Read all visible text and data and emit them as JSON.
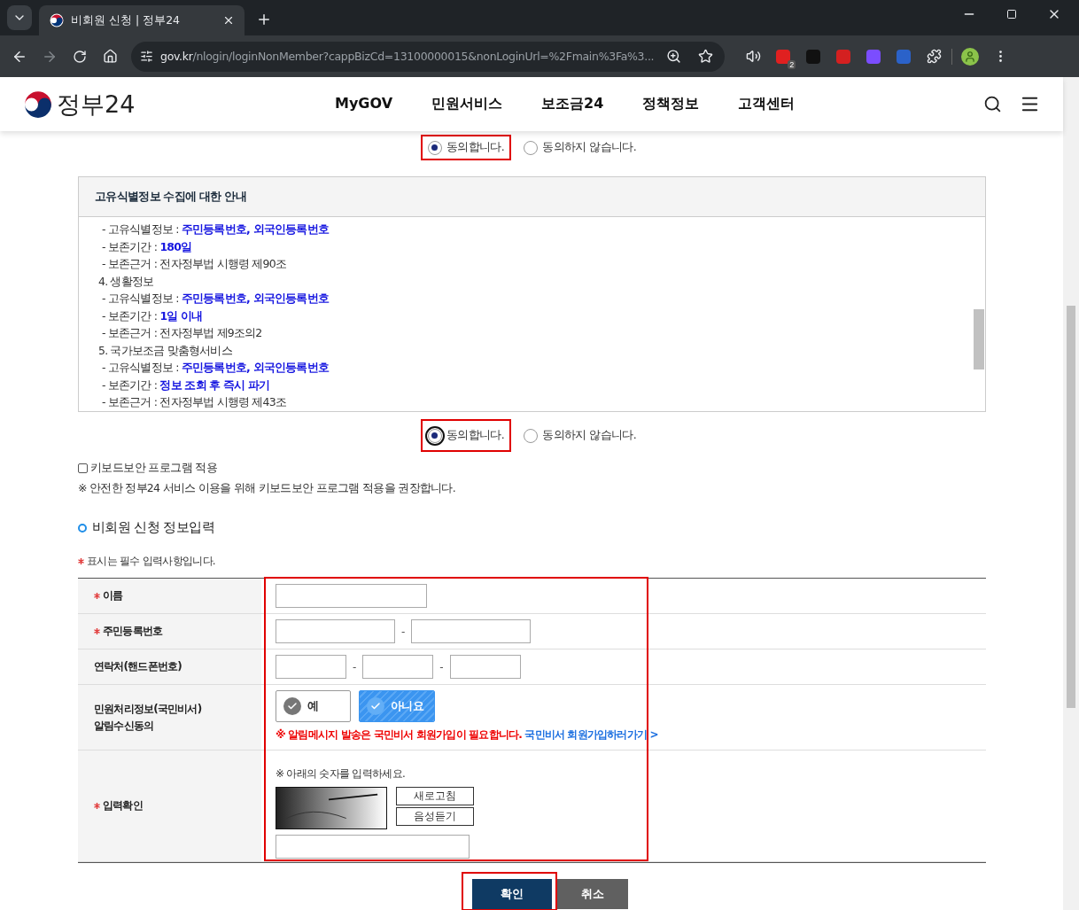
{
  "browser": {
    "tab_title": "비회원 신청 | 정부24",
    "url_host": "gov.kr",
    "url_path": "/nlogin/loginNonMember?cappBizCd=13100000015&nonLoginUrl=%2Fmain%3Fa%3...",
    "extensions": [
      {
        "color": "#e02020",
        "badge": "2"
      },
      {
        "color": "#111111"
      },
      {
        "color": "#d42020"
      },
      {
        "color": "#7b4dff"
      },
      {
        "color": "#2b62c9"
      }
    ]
  },
  "site": {
    "logo": "정부24",
    "nav": [
      "MyGOV",
      "민원서비스",
      "보조금24",
      "정책정보",
      "고객센터"
    ]
  },
  "consent_top": {
    "highlighted": true,
    "options": [
      {
        "label": "동의합니다.",
        "selected": true
      },
      {
        "label": "동의하지 않습니다.",
        "selected": false
      }
    ]
  },
  "notice": {
    "title": "고유식별정보 수집에 대한 안내",
    "lines": [
      {
        "kind": "item",
        "text": "- 고유식별정보 : **주민등록번호, 외국인등록번호**"
      },
      {
        "kind": "item",
        "text": "- 보존기간 : **180일**"
      },
      {
        "kind": "item",
        "text": "- 보존근거 : 전자정부법 시행령 제90조"
      },
      {
        "kind": "heading",
        "text": "4. 생활정보"
      },
      {
        "kind": "item",
        "text": "- 고유식별정보 : **주민등록번호, 외국인등록번호**"
      },
      {
        "kind": "item",
        "text": "- 보존기간 : **1일 이내**"
      },
      {
        "kind": "item",
        "text": "- 보존근거 : 전자정부법 제9조의2"
      },
      {
        "kind": "heading",
        "text": "5. 국가보조금 맞춤형서비스"
      },
      {
        "kind": "item",
        "text": "- 고유식별정보 : **주민등록번호, 외국인등록번호**"
      },
      {
        "kind": "item",
        "text": "- 보존기간 : **정보 조회 후 즉시 파기**"
      },
      {
        "kind": "item",
        "text": "- 보존근거 : 전자정부법 시행령 제43조"
      }
    ]
  },
  "consent_bottom": {
    "highlighted": true,
    "options": [
      {
        "label": "동의합니다.",
        "selected": true
      },
      {
        "label": "동의하지 않습니다.",
        "selected": false
      }
    ]
  },
  "keyboard_security": {
    "label": "키보드보안 프로그램 적용",
    "checked": false,
    "note": "※ 안전한 정부24 서비스 이용을 위해 키보드보안 프로그램 적용을 권장합니다."
  },
  "section_title": "비회원 신청 정보입력",
  "required_note": "표시는 필수 입력사항입니다.",
  "form": {
    "highlighted": true,
    "rows": [
      {
        "kind": "inputs",
        "label": "이름",
        "required": true
      },
      {
        "kind": "inputs",
        "label": "주민등록번호",
        "required": true,
        "separators": [
          "-"
        ]
      },
      {
        "kind": "inputs",
        "label": "연락처(핸드폰번호)",
        "required": false,
        "separators": [
          "-",
          "-"
        ]
      },
      {
        "kind": "choice",
        "label": "민원처리정보(국민비서)\n알림수신동의",
        "required": false,
        "options": [
          {
            "label": "예",
            "selected": false
          },
          {
            "label": "아니요",
            "selected": true
          }
        ],
        "warning": "※ 알림메시지 발송은 국민비서 회원가입이 필요합니다.",
        "link": "국민비서 회원가입하러가기 >"
      },
      {
        "kind": "captcha",
        "label": "입력확인",
        "required": true,
        "instruction": "※ 아래의 숫자를 입력하세요.",
        "buttons": [
          "새로고침",
          "음성듣기"
        ]
      }
    ]
  },
  "buttons": [
    {
      "label": "확인",
      "kind": "primary",
      "highlighted": true
    },
    {
      "label": "취소",
      "kind": "secondary",
      "highlighted": false
    }
  ]
}
